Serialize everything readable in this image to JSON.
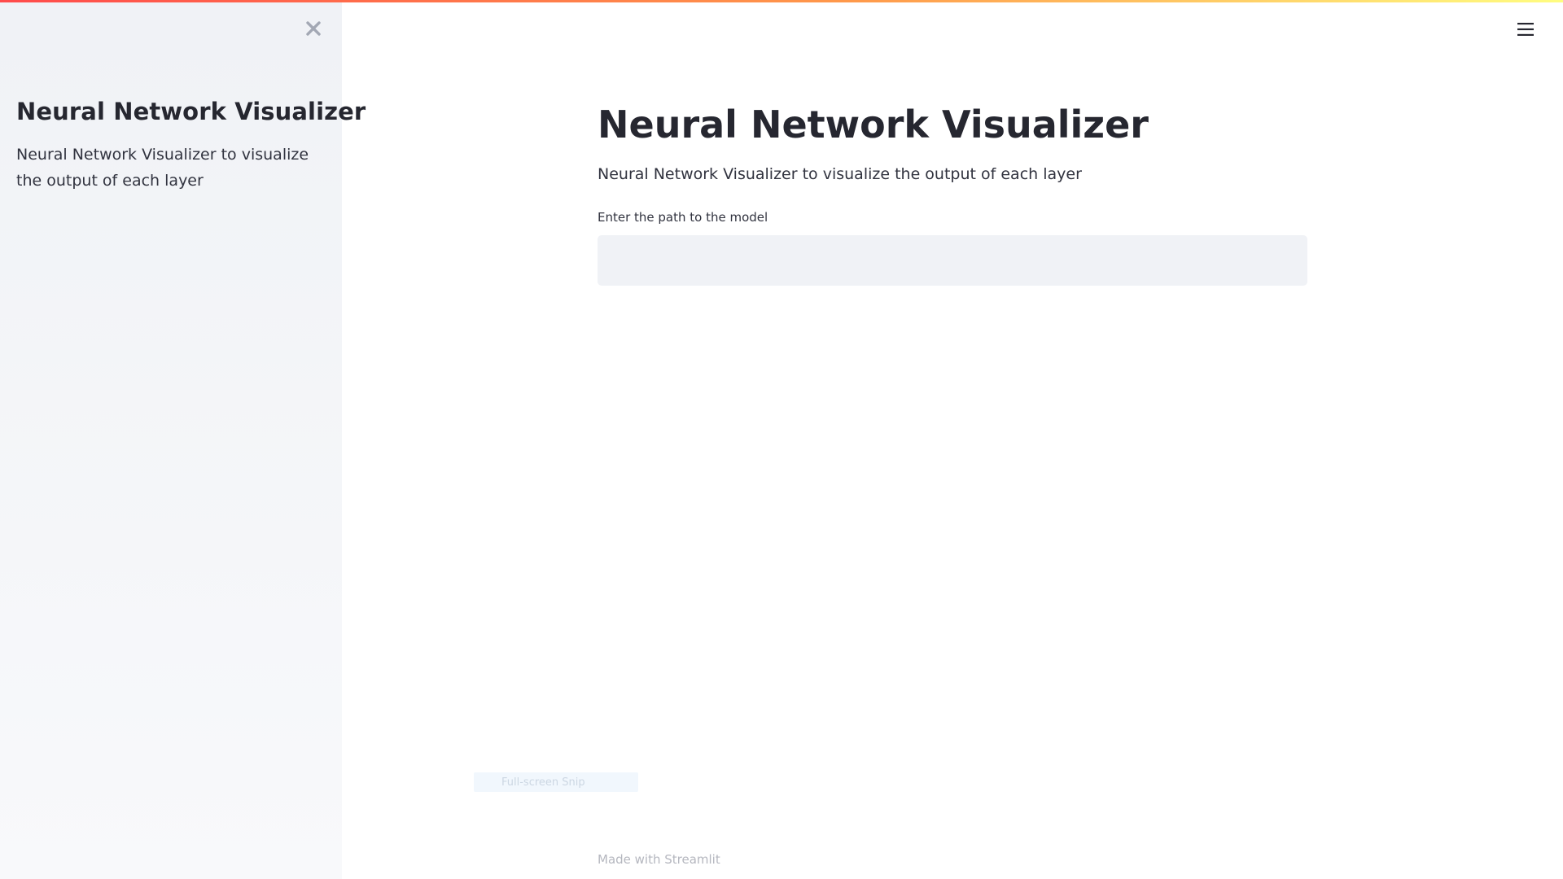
{
  "sidebar": {
    "title": "Neural Network Visualizer",
    "description": "Neural Network Visualizer to visualize the output of each layer",
    "close_icon": "close-icon"
  },
  "header": {
    "menu_icon": "hamburger-menu-icon"
  },
  "main": {
    "title": "Neural Network Visualizer",
    "description": "Neural Network Visualizer to visualize the output of each layer",
    "input_label": "Enter the path to the model",
    "input_value": "",
    "input_placeholder": ""
  },
  "overlay": {
    "snip_label": "Full-screen Snip"
  },
  "footer": {
    "text": "Made with Streamlit"
  },
  "colors": {
    "sidebar_bg": "#f0f2f6",
    "input_bg": "#f0f2f6",
    "text": "#262730",
    "accent_start": "#ff4b4b",
    "accent_end": "#fffd80",
    "footer_text": "#b5b7bf"
  }
}
